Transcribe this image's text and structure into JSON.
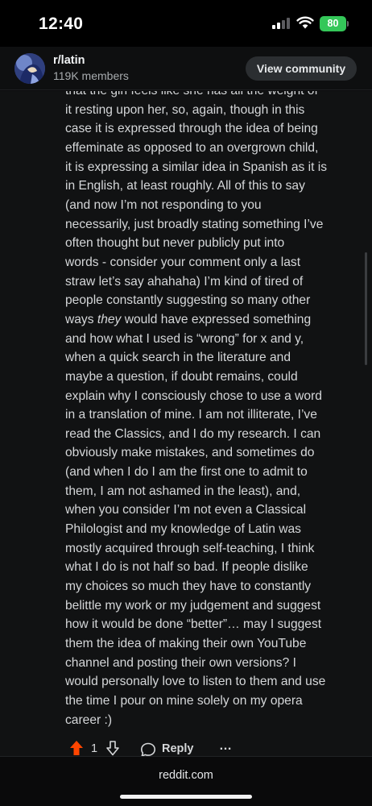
{
  "status_bar": {
    "time": "12:40",
    "battery": "80"
  },
  "community": {
    "name": "r/latin",
    "members": "119K members",
    "view_button": "View community"
  },
  "comment": {
    "lines": [
      "that the girl feels like she has all the weight of",
      "it resting upon her, so, again, though in this",
      "case it is expressed through the idea of being",
      "effeminate as opposed to an overgrown child,",
      "it is expressing a similar idea in Spanish as it is",
      "in English, at least roughly. All of this to say",
      "(and now I’m not responding to you",
      "necessarily, just broadly stating something I’ve",
      "often thought but never publicly put into",
      "words - consider your comment only a last",
      "straw let’s say ahahaha) I’m kind of tired of",
      "people constantly suggesting so many other"
    ],
    "line13_before": "ways ",
    "line13_emphasis": "they",
    "line13_after": " would have expressed something",
    "lines_rest": [
      "and how what I used is “wrong” for x and y,",
      "when a quick search in the literature and",
      "maybe a question, if doubt remains, could",
      "explain why I consciously chose to use a word",
      "in a translation of mine. I am not illiterate, I’ve",
      "read the Classics, and I do my research. I can",
      "obviously make mistakes, and sometimes do",
      "(and when I do I am the first one to admit to",
      "them, I am not ashamed in the least), and,",
      "when you consider I’m not even a Classical",
      "Philologist and my knowledge of Latin was",
      "mostly acquired through self-teaching, I think",
      "what I do is not half so bad. If people dislike",
      "my choices so much they have to constantly",
      "belittle my work or my judgement and suggest",
      "how it would be done “better”… may I suggest",
      "them the idea of making their own YouTube",
      "channel and posting their own versions? I",
      "would personally love to listen to them and use",
      "the time I pour on mine solely on my opera",
      "career :)"
    ]
  },
  "actions": {
    "vote_count": "1",
    "reply_label": "Reply",
    "more_label": "…"
  },
  "footer": {
    "domain": "reddit.com"
  },
  "colors": {
    "upvote": "#ff4500",
    "battery": "#34c759",
    "background": "#111213"
  },
  "icons": [
    "signal-icon",
    "wifi-icon",
    "battery-icon",
    "community-avatar",
    "upvote-icon",
    "downvote-icon",
    "reply-icon",
    "more-icon"
  ]
}
